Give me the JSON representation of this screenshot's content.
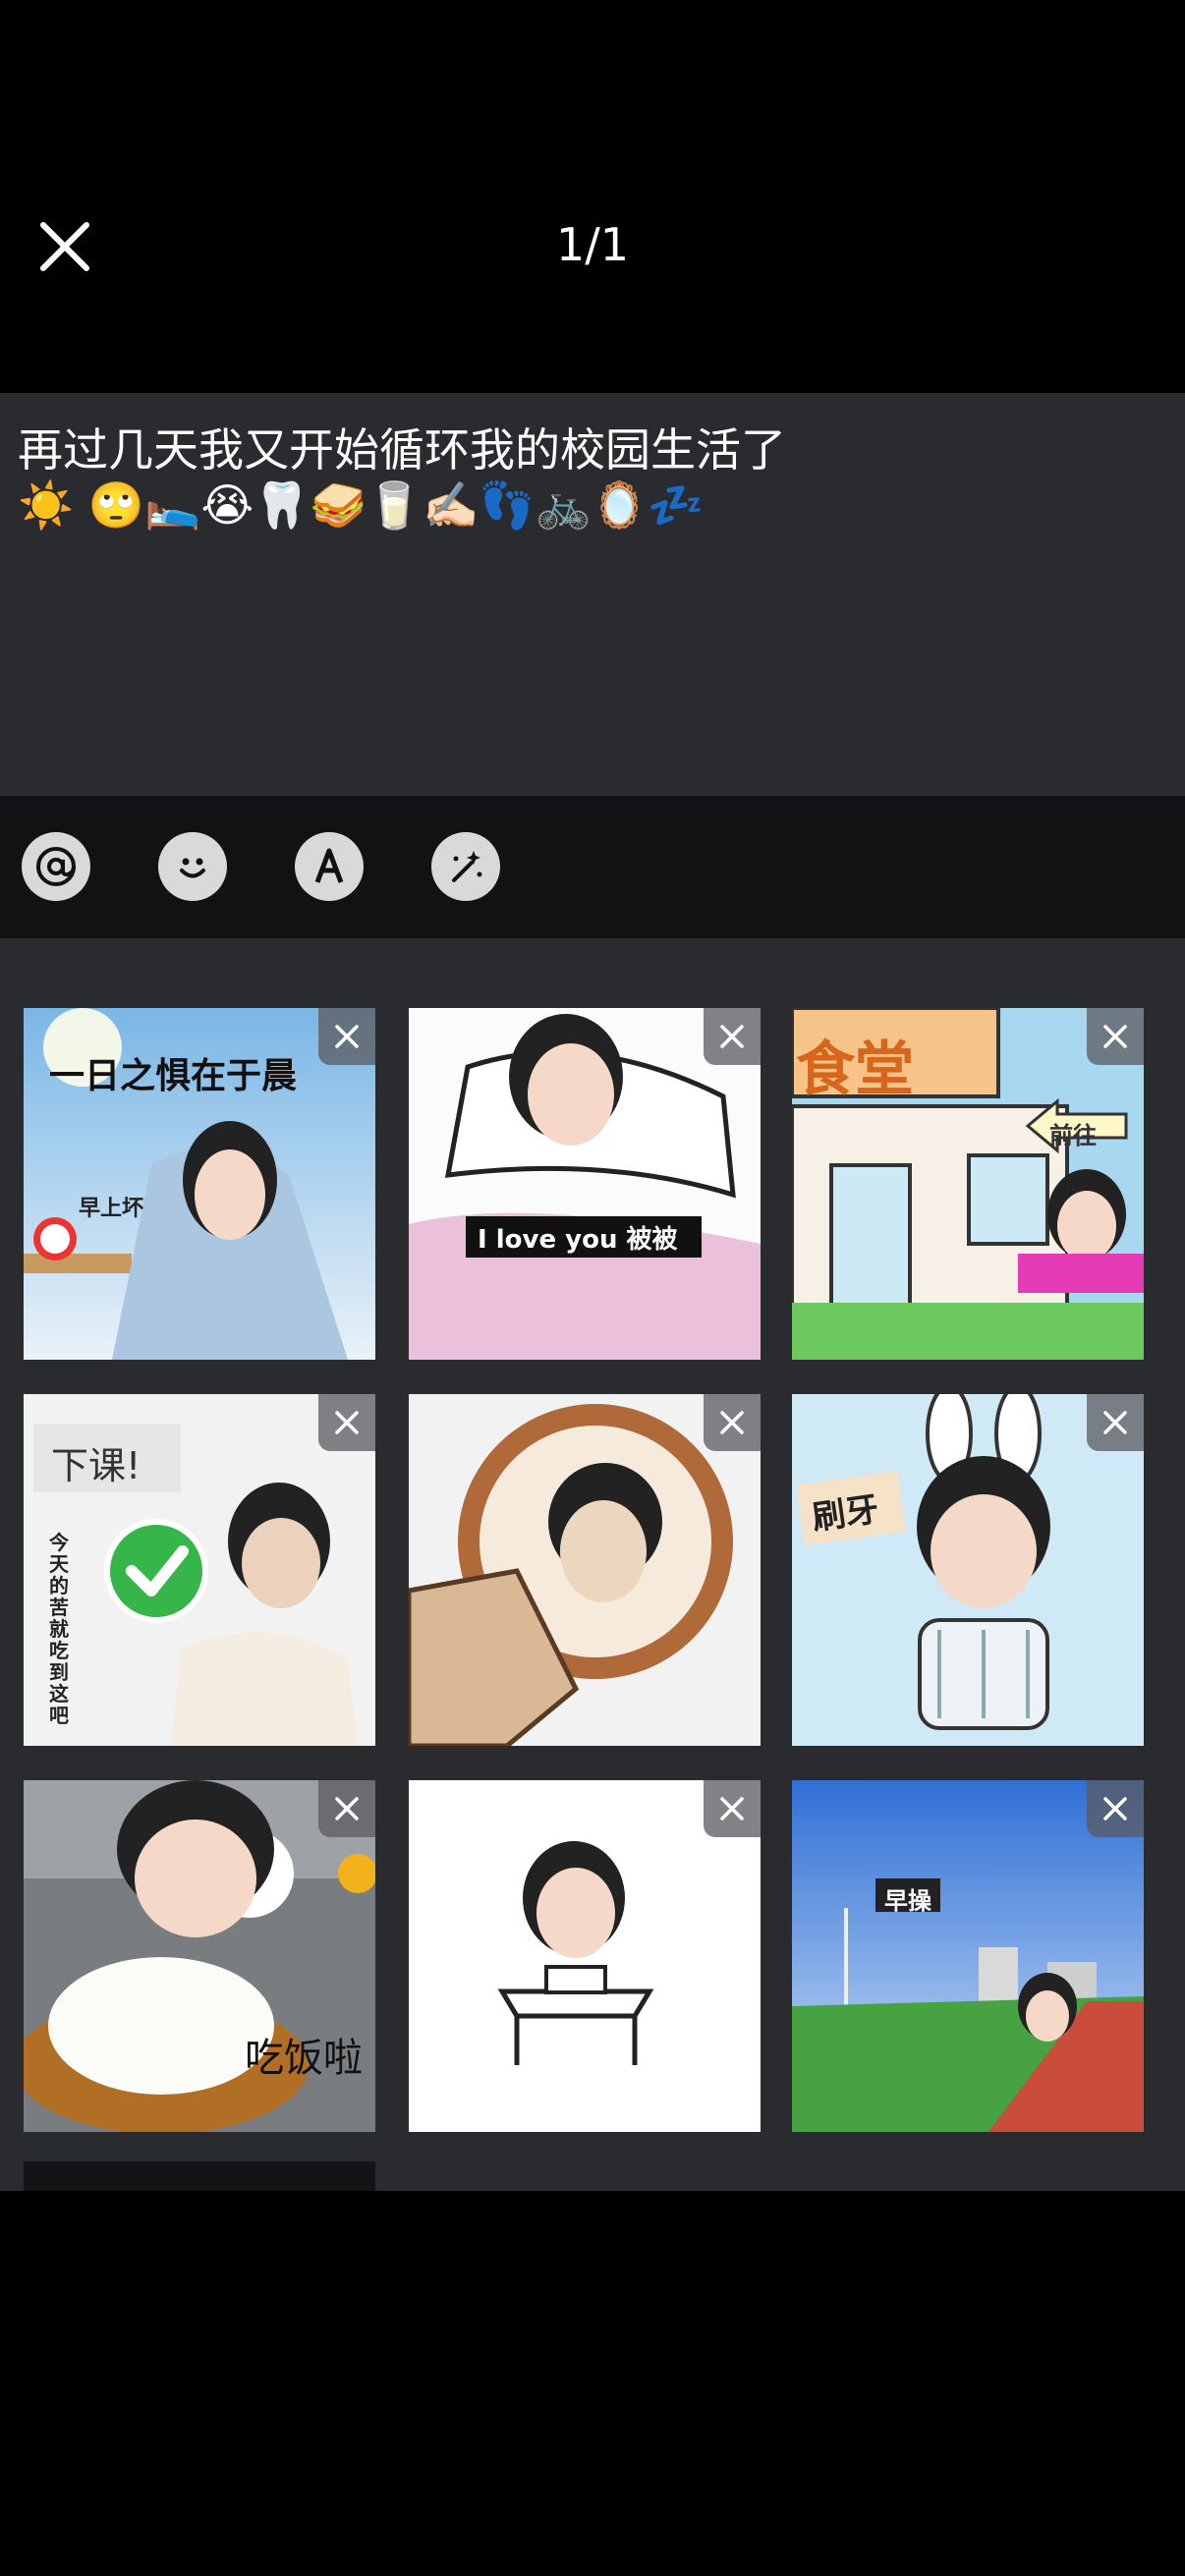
{
  "header": {
    "counter": "1/1"
  },
  "post": {
    "text": "再过几天我又开始循环我的校园生活了\n☀️ 🙄🛌😭🦷🥪🥛✍🏻👣🚲🪞💤"
  },
  "toolbar": {
    "icons": [
      "at-icon",
      "emoji-icon",
      "font-icon",
      "magic-wand-icon"
    ]
  },
  "stickers": [
    {
      "caption": "一日之惧在于晨",
      "caption2": "早上坏",
      "theme": "bed-morning"
    },
    {
      "caption": "I love you 被被",
      "theme": "pink-blanket"
    },
    {
      "caption": "食堂",
      "caption2": "前往",
      "theme": "canteen"
    },
    {
      "caption": "下课!",
      "caption2": "今天的苦就吃到这吧",
      "theme": "class-over"
    },
    {
      "caption": "",
      "theme": "mirror"
    },
    {
      "caption": "刷牙",
      "theme": "brush-teeth"
    },
    {
      "caption": "吃饭啦",
      "theme": "rice-meal"
    },
    {
      "caption": "",
      "theme": "study-desk"
    },
    {
      "caption": "早操",
      "theme": "playground"
    }
  ],
  "colors": {
    "background": "#000000",
    "panel": "#2a2b2f",
    "toolbar": "#111214",
    "tool_icon_bg": "#d9d9dc"
  }
}
